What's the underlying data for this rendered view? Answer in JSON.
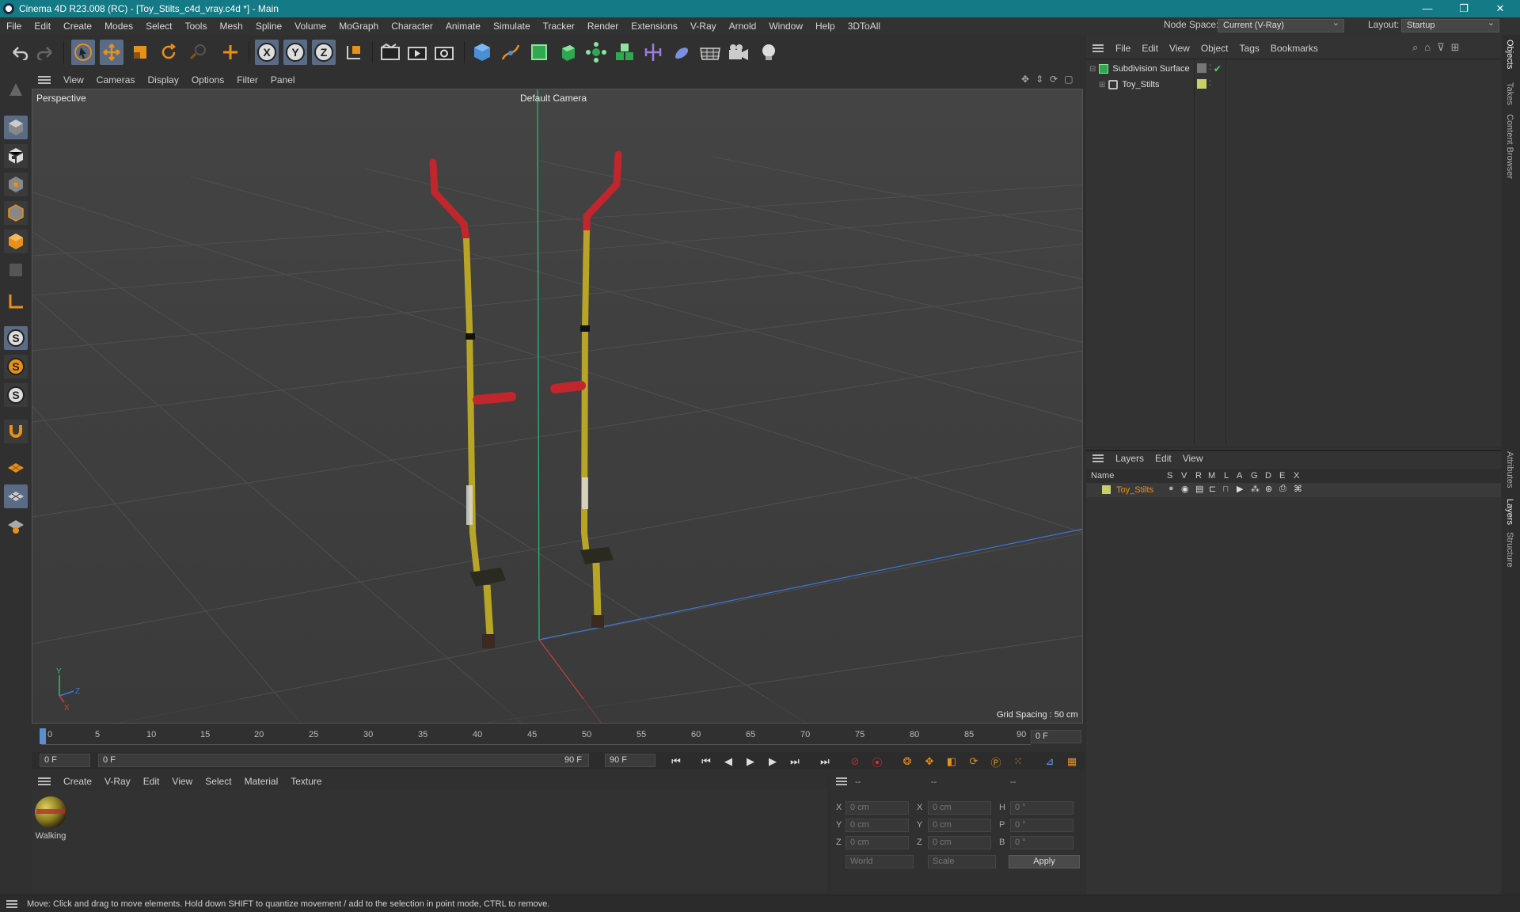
{
  "window": {
    "title": "Cinema 4D R23.008 (RC) - [Toy_Stilts_c4d_vray.c4d *] - Main",
    "controls": [
      "—",
      "❐",
      "✕"
    ]
  },
  "menubar": [
    "File",
    "Edit",
    "Create",
    "Modes",
    "Select",
    "Tools",
    "Mesh",
    "Spline",
    "Volume",
    "MoGraph",
    "Character",
    "Animate",
    "Simulate",
    "Tracker",
    "Render",
    "Extensions",
    "V-Ray",
    "Arnold",
    "Window",
    "Help",
    "3DToAll"
  ],
  "nodespace": {
    "label": "Node Space:",
    "value": "Current (V-Ray)"
  },
  "layout": {
    "label": "Layout:",
    "value": "Startup"
  },
  "toolbar_icons": [
    "undo-icon",
    "redo-icon",
    "select-icon",
    "move-icon",
    "scale-icon",
    "rotate-icon",
    "live-selection-icon",
    "add-icon",
    "x-axis-icon",
    "y-axis-icon",
    "z-axis-icon",
    "coord-system-icon",
    "render-region-icon",
    "render-view-icon",
    "render-settings-icon",
    "cube-icon",
    "pen-icon",
    "subdivision-icon",
    "extrude-icon",
    "array-icon",
    "cloner-icon",
    "symmetry-icon",
    "deformer-icon",
    "floor-icon",
    "camera-icon",
    "light-icon"
  ],
  "viewport": {
    "menu": [
      "View",
      "Cameras",
      "Display",
      "Options",
      "Filter",
      "Panel"
    ],
    "view_name": "Perspective",
    "camera": "Default Camera",
    "grid_spacing": "Grid Spacing : 50 cm"
  },
  "timeline": {
    "ticks": [
      "0",
      "5",
      "10",
      "15",
      "20",
      "25",
      "30",
      "35",
      "40",
      "45",
      "50",
      "55",
      "60",
      "65",
      "70",
      "75",
      "80",
      "85",
      "90"
    ],
    "current_frame": "0 F",
    "start": "0 F",
    "range_start": "0 F",
    "range_end": "90 F",
    "end": "90 F"
  },
  "materials": {
    "menu": [
      "Create",
      "V-Ray",
      "Edit",
      "View",
      "Select",
      "Material",
      "Texture"
    ],
    "items": [
      {
        "name": "Walking"
      }
    ]
  },
  "coordinates": {
    "headers": [
      "--",
      "--",
      "--"
    ],
    "rows": [
      {
        "a": "X",
        "av": "0 cm",
        "b": "X",
        "bv": "0 cm",
        "c": "H",
        "cv": "0 °"
      },
      {
        "a": "Y",
        "av": "0 cm",
        "b": "Y",
        "bv": "0 cm",
        "c": "P",
        "cv": "0 °"
      },
      {
        "a": "Z",
        "av": "0 cm",
        "b": "Z",
        "bv": "0 cm",
        "c": "B",
        "cv": "0 °"
      }
    ],
    "mode1": "World",
    "mode2": "Scale",
    "apply": "Apply"
  },
  "objects": {
    "menu": [
      "File",
      "Edit",
      "View",
      "Object",
      "Tags",
      "Bookmarks"
    ],
    "items": [
      "Subdivision Surface",
      "Toy_Stilts"
    ]
  },
  "layers": {
    "menu": [
      "Layers",
      "Edit",
      "View"
    ],
    "columns": [
      "Name",
      "S",
      "V",
      "R",
      "M",
      "L",
      "A",
      "G",
      "D",
      "E",
      "X"
    ],
    "items": [
      {
        "name": "Toy_Stilts",
        "color": "#c8d06a"
      }
    ]
  },
  "side_tabs": [
    "Objects",
    "Takes",
    "Content Browser",
    "Attributes",
    "Layers",
    "Structure"
  ],
  "status": "Move: Click and drag to move elements. Hold down SHIFT to quantize movement / add to the selection in point mode, CTRL to remove.",
  "colors": {
    "titlebar": "#137a86",
    "accent": "#e8901a",
    "stilt_yellow": "#b8a525",
    "stilt_red": "#c0262c"
  }
}
